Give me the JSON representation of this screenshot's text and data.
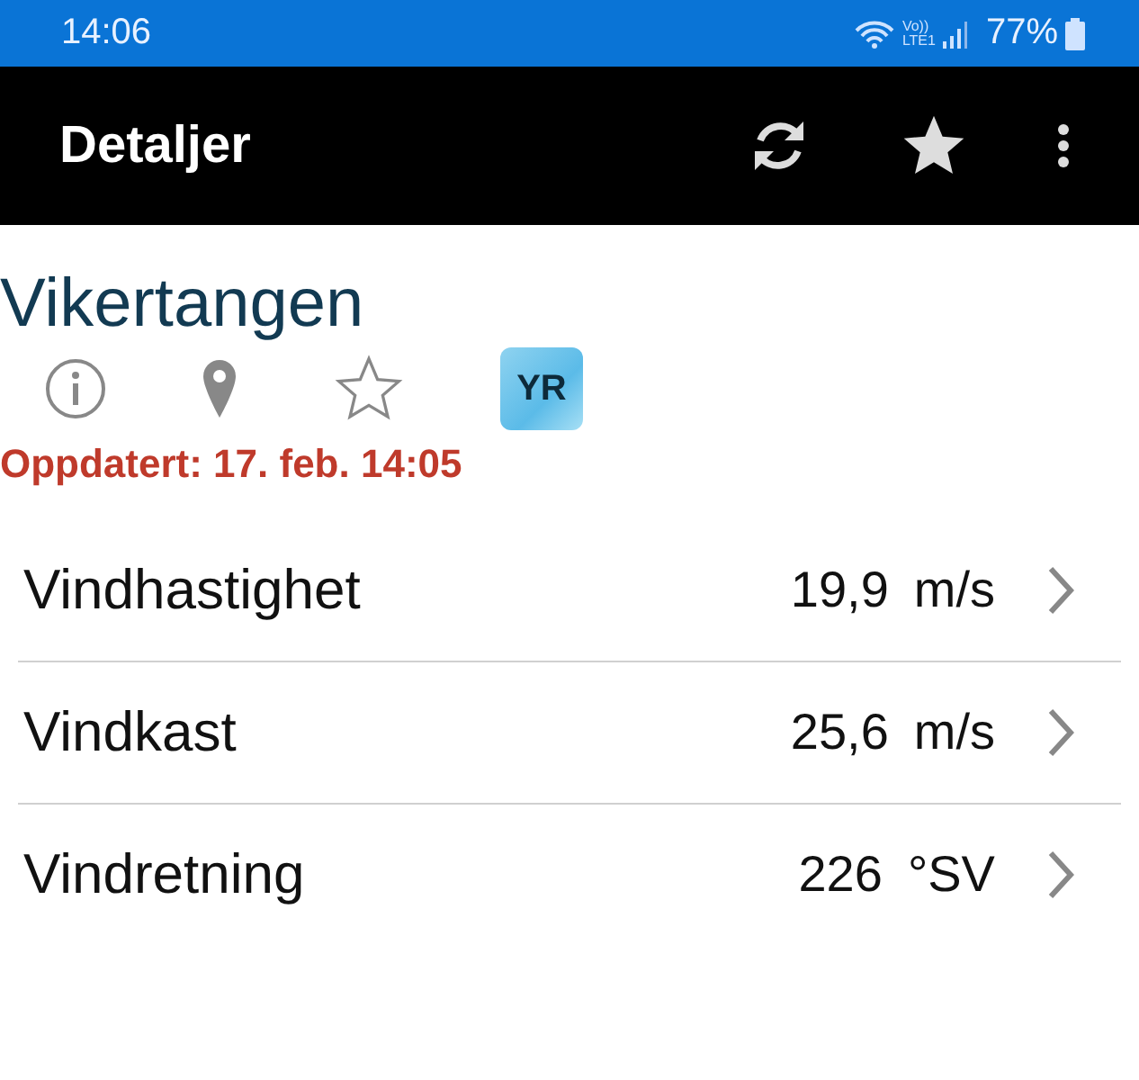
{
  "status_bar": {
    "time": "14:06",
    "volte": "Vo))",
    "network": "LTE1",
    "battery": "77%"
  },
  "app_bar": {
    "title": "Detaljer"
  },
  "station": {
    "name": "Vikertangen",
    "logo": "YR",
    "updated": "Oppdatert: 17. feb. 14:05"
  },
  "rows": [
    {
      "label": "Vindhastighet",
      "value": "19,9",
      "unit": "m/s"
    },
    {
      "label": "Vindkast",
      "value": "25,6",
      "unit": "m/s"
    },
    {
      "label": "Vindretning",
      "value": "226",
      "unit": "°SV"
    }
  ]
}
